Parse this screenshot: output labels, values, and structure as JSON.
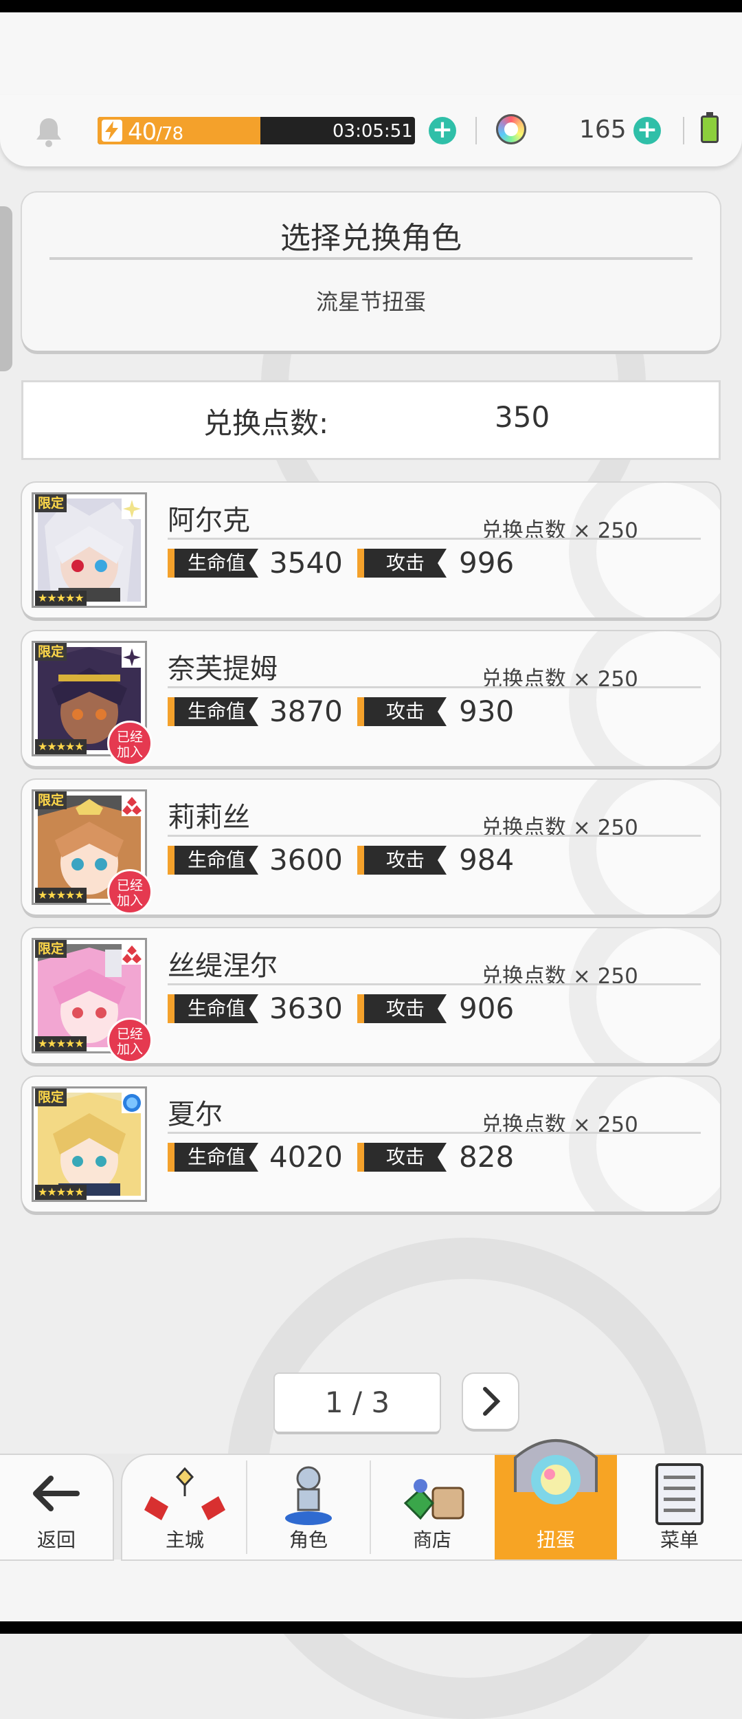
{
  "hud": {
    "stamina_current": "40",
    "stamina_max": "/78",
    "stamina_fraction": 0.513,
    "timer": "03:05:51",
    "gems": "165"
  },
  "panel": {
    "title": "选择兑换角色",
    "subtitle": "流星节扭蛋"
  },
  "points": {
    "label": "兑换点数:",
    "value": "350"
  },
  "characters": [
    {
      "name": "阿尔克",
      "cost": "兑换点数 × 250",
      "hp_label": "生命值",
      "hp": "3540",
      "atk_label": "攻击",
      "atk": "996",
      "tag": "限定",
      "stars": "★★★★★",
      "element": "light",
      "joined": false
    },
    {
      "name": "奈芙提姆",
      "cost": "兑换点数 × 250",
      "hp_label": "生命值",
      "hp": "3870",
      "atk_label": "攻击",
      "atk": "930",
      "tag": "限定",
      "stars": "★★★★★",
      "element": "dark",
      "joined": true,
      "joined_label_1": "已经",
      "joined_label_2": "加入"
    },
    {
      "name": "莉莉丝",
      "cost": "兑换点数 × 250",
      "hp_label": "生命值",
      "hp": "3600",
      "atk_label": "攻击",
      "atk": "984",
      "tag": "限定",
      "stars": "★★★★★",
      "element": "fire",
      "joined": true,
      "joined_label_1": "已经",
      "joined_label_2": "加入"
    },
    {
      "name": "丝缇涅尔",
      "cost": "兑换点数 × 250",
      "hp_label": "生命值",
      "hp": "3630",
      "atk_label": "攻击",
      "atk": "906",
      "tag": "限定",
      "stars": "★★★★★",
      "element": "fire",
      "joined": true,
      "joined_label_1": "已经",
      "joined_label_2": "加入"
    },
    {
      "name": "夏尔",
      "cost": "兑换点数 × 250",
      "hp_label": "生命值",
      "hp": "4020",
      "atk_label": "攻击",
      "atk": "828",
      "tag": "限定",
      "stars": "★★★★★",
      "element": "water",
      "joined": false
    }
  ],
  "pagination": {
    "label": "1 / 3"
  },
  "nav": {
    "back": "返回",
    "items": [
      "主城",
      "角色",
      "商店",
      "扭蛋",
      "菜单"
    ],
    "active": "扭蛋"
  },
  "colors": {
    "accent": "#f4a12b",
    "plus": "#2fbfa8",
    "badge": "#e53950",
    "stat_tag": "#2c2c2c"
  }
}
